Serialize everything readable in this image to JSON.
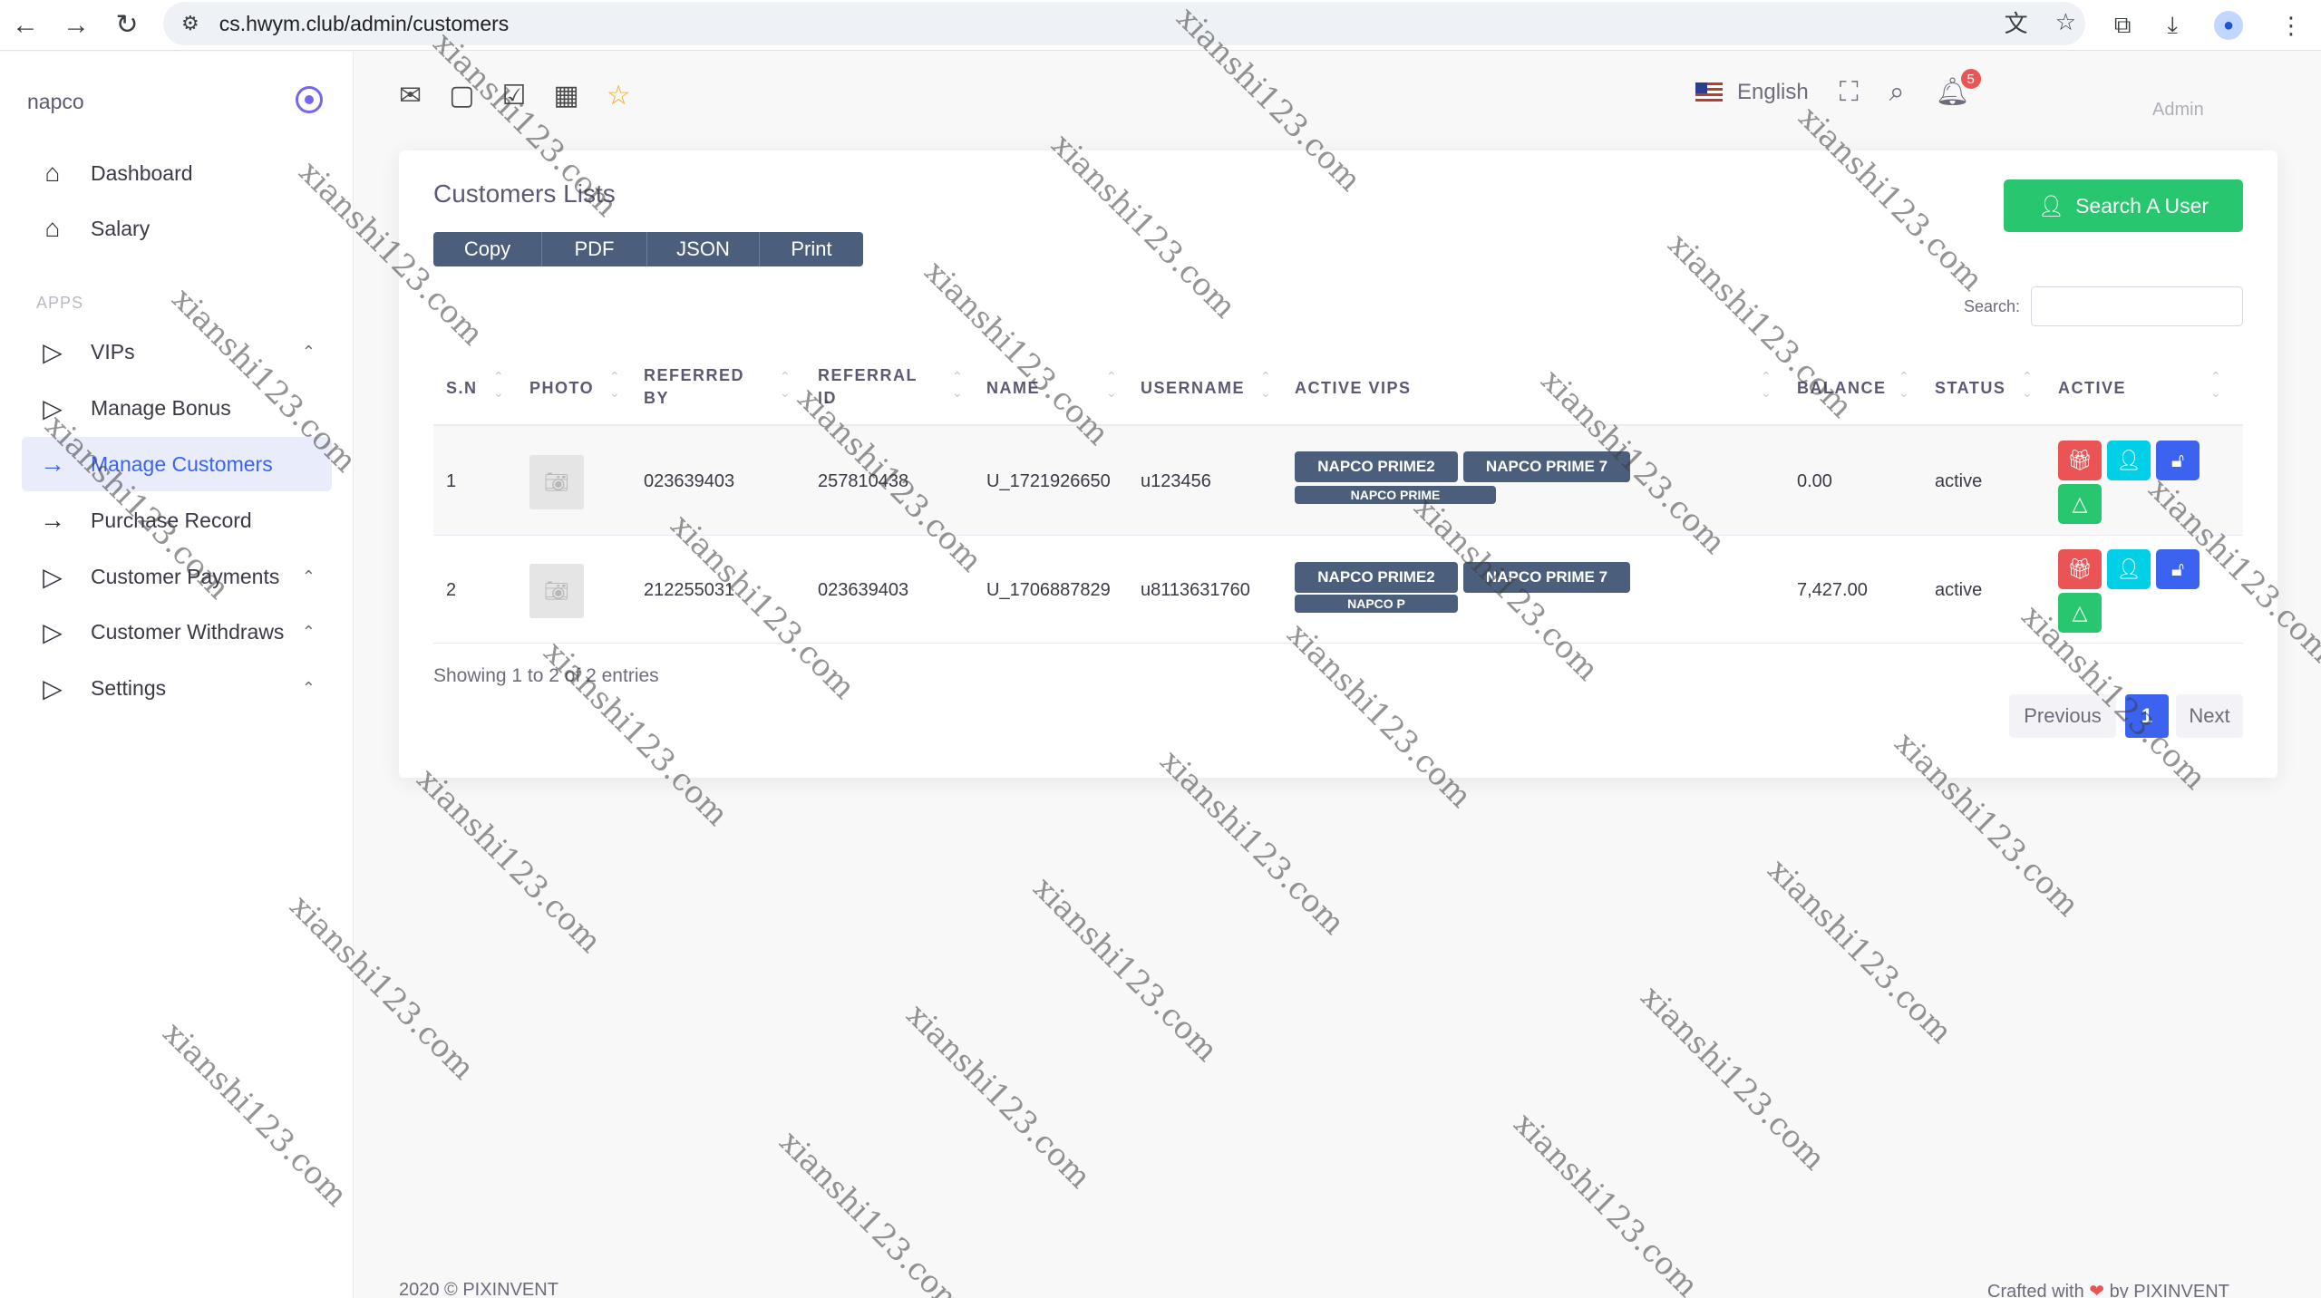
{
  "browser": {
    "url": "cs.hwym.club/admin/customers"
  },
  "sidebar": {
    "brand": "napco",
    "section_label": "APPS",
    "items": [
      {
        "label": "Dashboard",
        "icon": "home-icon"
      },
      {
        "label": "Salary",
        "icon": "home-icon"
      },
      {
        "label": "VIPs",
        "icon": "play-icon"
      },
      {
        "label": "Manage Bonus",
        "icon": "play-icon"
      },
      {
        "label": "Manage Customers",
        "icon": "arrow-right-icon"
      },
      {
        "label": "Purchase Record",
        "icon": "arrow-right-icon"
      },
      {
        "label": "Customer Payments",
        "icon": "play-icon"
      },
      {
        "label": "Customer Withdraws",
        "icon": "play-icon"
      },
      {
        "label": "Settings",
        "icon": "play-icon"
      }
    ]
  },
  "topbar": {
    "language": "English",
    "notification_count": "5",
    "user_name": "Admin"
  },
  "card": {
    "title": "Customers Lists",
    "search_user_button": "Search A User",
    "export_buttons": [
      "Copy",
      "PDF",
      "JSON",
      "Print"
    ],
    "search_label": "Search:",
    "search_value": ""
  },
  "table": {
    "columns": [
      "S.N",
      "PHOTO",
      "REFERRED BY",
      "REFERRAL ID",
      "NAME",
      "USERNAME",
      "ACTIVE VIPS",
      "BALANCE",
      "STATUS",
      "ACTIVE"
    ],
    "rows": [
      {
        "sn": "1",
        "referred_by": "023639403",
        "referral_id": "257810438",
        "name": "U_1721926650",
        "username": "u123456",
        "active_vips": [
          "NAPCO PRIME2",
          "NAPCO PRIME 7",
          "NAPCO PRIME"
        ],
        "balance": "0.00",
        "status": "active"
      },
      {
        "sn": "2",
        "referred_by": "212255031",
        "referral_id": "023639403",
        "name": "U_1706887829",
        "username": "u8113631760",
        "active_vips": [
          "NAPCO PRIME2",
          "NAPCO PRIME 7",
          "NAPCO P"
        ],
        "balance": "7,427.00",
        "status": "active"
      }
    ],
    "showing": "Showing 1 to 2 of 2 entries",
    "pagination": {
      "previous": "Previous",
      "page": "1",
      "next": "Next"
    }
  },
  "footer": {
    "left": "2020 © PIXINVENT",
    "right_prefix": "Crafted with",
    "right_suffix": "by PIXINVENT"
  },
  "watermark": "xianshi123.com",
  "colors": {
    "primary": "#3b63f0",
    "success": "#28c76f",
    "danger": "#ea5455",
    "info": "#00cfe8",
    "badge_dark": "#4b5f7c"
  }
}
